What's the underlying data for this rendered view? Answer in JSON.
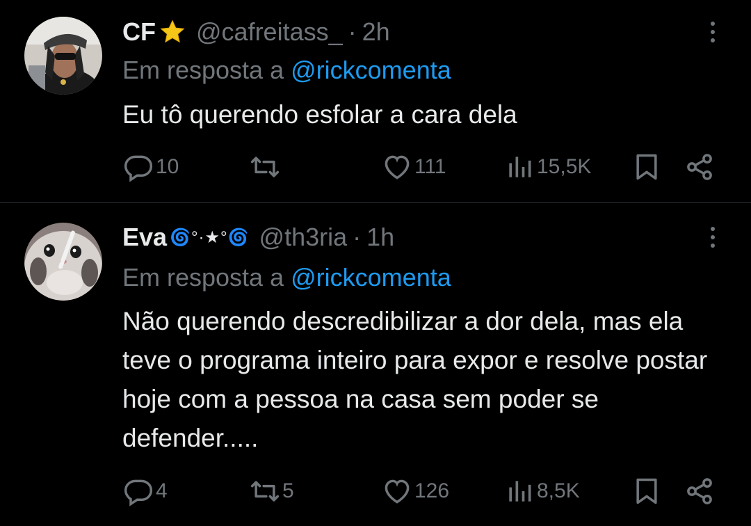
{
  "tweets": [
    {
      "name": "CF",
      "name_emoji": "⭐",
      "handle": "@cafreitass_",
      "separator": "·",
      "time": "2h",
      "reply_prefix": "Em resposta a",
      "reply_mention": "@rickcomenta",
      "text": "Eu tô querendo esfolar a cara dela",
      "stats": {
        "replies": "10",
        "retweets": "",
        "likes": "111",
        "views": "15,5K"
      }
    },
    {
      "name": "Eva",
      "name_emoji": "🌀°·★°🌀",
      "handle": "@th3ria",
      "separator": "·",
      "time": "1h",
      "reply_prefix": "Em resposta a",
      "reply_mention": "@rickcomenta",
      "text": "Não querendo descredibilizar a dor dela, mas ela teve o programa inteiro para expor e resolve postar hoje com a pessoa na casa sem poder se defender.....",
      "stats": {
        "replies": "4",
        "retweets": "5",
        "likes": "126",
        "views": "8,5K"
      }
    }
  ],
  "icons": {
    "reply": "reply-icon",
    "retweet": "retweet-icon",
    "like": "heart-icon",
    "views": "views-icon",
    "bookmark": "bookmark-icon",
    "share": "share-icon",
    "more": "more-icon"
  },
  "colors": {
    "background": "#000000",
    "text": "#e7e9ea",
    "muted": "#71767b",
    "mention": "#1d9bf0",
    "divider": "#2f3336"
  }
}
